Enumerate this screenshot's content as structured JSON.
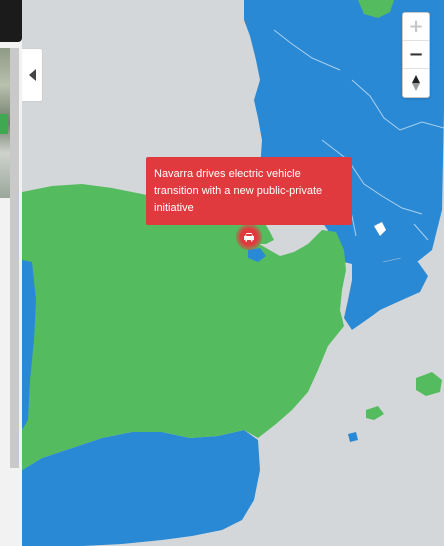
{
  "map": {
    "zoom_in_label": "+",
    "zoom_out_label": "−",
    "colors": {
      "sea": "#d3d7d9",
      "highlight_green": "#55bb5f",
      "highlight_blue": "#2a89d4",
      "accent_red": "#e03a3e"
    },
    "popup": {
      "text": "Navarra drives electric vehicle transition with a new public-private initiative"
    },
    "marker": {
      "icon": "car-icon"
    }
  },
  "side_panel": {
    "collapse_icon": "chevron-left-icon"
  }
}
